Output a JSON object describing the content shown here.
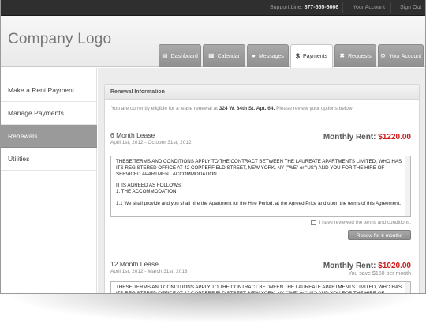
{
  "topbar": {
    "support_label": "Support Line:",
    "support_phone": "877-555-6666",
    "your_account": "Your Account",
    "sign_out": "Sign Out"
  },
  "header": {
    "logo": "Company Logo",
    "tabs": [
      {
        "label": "Dashboard",
        "icon": "dashboard-icon"
      },
      {
        "label": "Calendar",
        "icon": "calendar-icon"
      },
      {
        "label": "Messages",
        "icon": "messages-icon"
      },
      {
        "label": "Payments",
        "icon": "dollar-icon",
        "active": true
      },
      {
        "label": "Requests",
        "icon": "tools-icon"
      },
      {
        "label": "Your Account",
        "icon": "gears-icon"
      }
    ]
  },
  "sidebar": {
    "items": [
      {
        "label": "Make a Rent Payment"
      },
      {
        "label": "Manage Payments"
      },
      {
        "label": "Renewals",
        "active": true
      },
      {
        "label": "Utilities"
      }
    ]
  },
  "panel": {
    "title": "Renewal Information",
    "intro_before": "You are currently eligible for a lease renewal at",
    "intro_address": "324 W. 84th St. Apt. 64.",
    "intro_after": "Please review your options below:"
  },
  "leases": [
    {
      "title": "6 Month Lease",
      "dates": "April 1st, 2012 - October 31st, 2012",
      "rent_label": "Monthly Rent:",
      "rent_amount": "$1220.00",
      "terms_p1": "THESE TERMS AND CONDITIONS APPLY TO THE CONTRACT BETWEEN THE LAUREATE APARTMENTS LIMITED, WHO HAS ITS REGISTERED OFFICE AT 42 COPPERFIELD STREET, NEW YORK, NY (\"WE\" or \"US\") AND YOU FOR THE HIRE OF SERVICED APARTMENT ACCOMMODATION.",
      "terms_p2a": "IT IS AGREED AS FOLLOWS:",
      "terms_p2b": "1. THE ACCOMMODATION",
      "terms_p3": "1.1 We shall provide and you shall hire the Apartment for the Hire Period, at the Agreed Price and upon the terms of this Agreement.",
      "review_label": "I have reviewed the terms and conditions.",
      "button": "Renew for 6 months"
    },
    {
      "title": "12 Month Lease",
      "dates": "April 1st, 2012 - March 31st, 2013",
      "rent_label": "Monthly Rent:",
      "rent_amount": "$1020.00",
      "savings": "You save $150 per month",
      "terms_p1": "THESE TERMS AND CONDITIONS APPLY TO THE CONTRACT BETWEEN THE LAUREATE APARTMENTS LIMITED, WHO HAS ITS REGISTERED OFFICE AT 42 COPPERFIELD STREET, NEW YORK, NY (\"WE\" or \"US\") AND YOU FOR THE HIRE OF SERVICED APARTMENT ACCOMMODATION."
    }
  ],
  "colors": {
    "rent_red": "#d01818",
    "active_sidebar": "#9a9a9a",
    "topbar": "#2f2f2f"
  }
}
